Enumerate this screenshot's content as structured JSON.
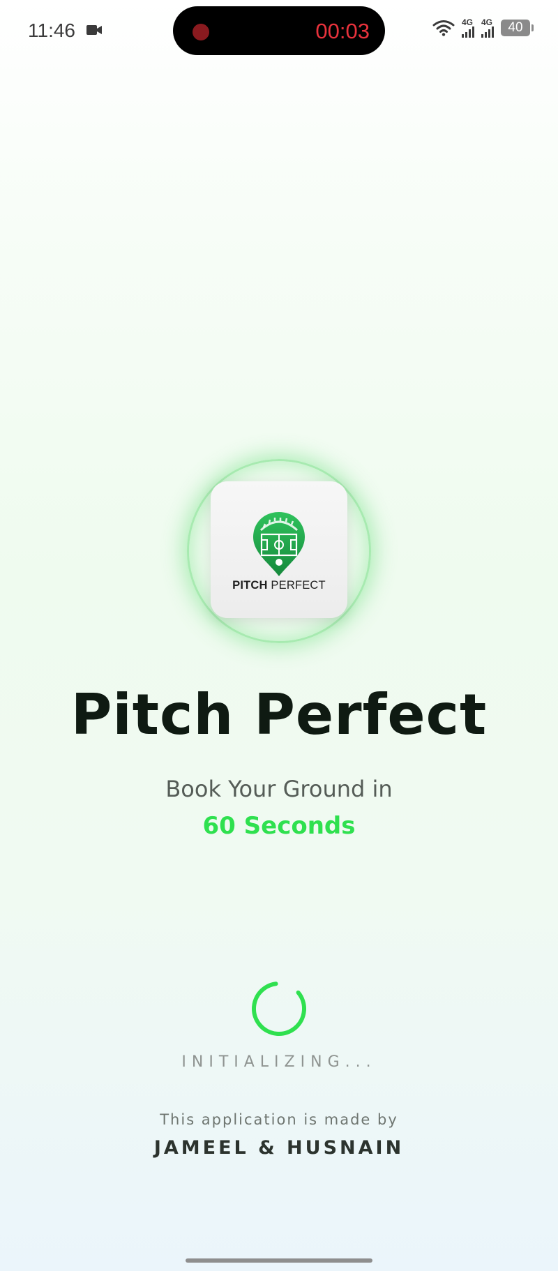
{
  "status_bar": {
    "time": "11:46",
    "recording_timer": "00:03",
    "network_1": "4G",
    "network_2": "4G",
    "battery": "40",
    "icons": [
      "camera-icon",
      "record-dot-icon",
      "wifi-icon",
      "signal-icon",
      "battery-icon"
    ]
  },
  "logo": {
    "text_bold": "PITCH",
    "text_regular": " PERFECT",
    "icon": "pitch-location-pin-icon"
  },
  "splash": {
    "title": "Pitch Perfect",
    "tagline": "Book Your Ground in",
    "tagline_highlight": "60 Seconds",
    "status": "INITIALIZING...",
    "credit_line": "This application is made by",
    "credit_names": "JAMEEL & HUSNAIN"
  },
  "colors": {
    "accent": "#2fe04f",
    "logo_green": "#1fa54a",
    "title": "#0f1a12",
    "record_timer": "#e8323c"
  }
}
